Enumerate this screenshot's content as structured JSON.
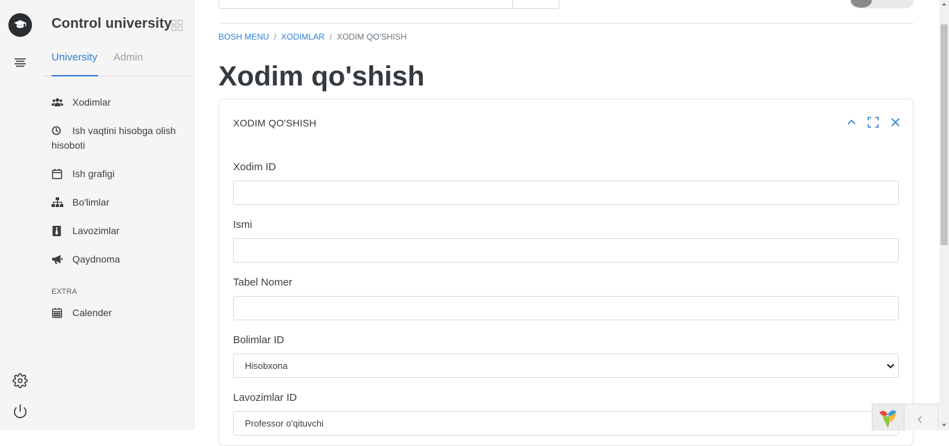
{
  "app": {
    "name": "Control university"
  },
  "tabs": [
    {
      "label": "University",
      "active": true
    },
    {
      "label": "Admin",
      "active": false
    }
  ],
  "nav": {
    "items": [
      {
        "label": "Xodimlar",
        "icon": "users-icon"
      },
      {
        "label": "Ish vaqtini hisobga olish hisoboti",
        "icon": "clock-icon"
      },
      {
        "label": "Ish grafigi",
        "icon": "calendar-icon"
      },
      {
        "label": "Bo'limlar",
        "icon": "sitemap-icon"
      },
      {
        "label": "Lavozimlar",
        "icon": "id-badge-icon"
      },
      {
        "label": "Qaydnoma",
        "icon": "megaphone-icon"
      }
    ],
    "extra_label": "EXTRA",
    "extra_items": [
      {
        "label": "Calender",
        "icon": "calendar-grid-icon"
      }
    ]
  },
  "breadcrumb": {
    "home": "BOSH MENU",
    "section": "XODIMLAR",
    "current": "XODIM QO'SHISH"
  },
  "page": {
    "title": "Xodim qo'shish"
  },
  "card": {
    "title": "XODIM QO'SHISH",
    "fields": [
      {
        "label": "Xodim ID",
        "type": "text",
        "value": ""
      },
      {
        "label": "Ismi",
        "type": "text",
        "value": ""
      },
      {
        "label": "Tabel Nomer",
        "type": "text",
        "value": ""
      },
      {
        "label": "Bolimlar ID",
        "type": "select",
        "value": "Hisobxona"
      },
      {
        "label": "Lavozimlar ID",
        "type": "select",
        "value": "Professor o'qituvchi"
      }
    ]
  },
  "colors": {
    "accent": "#2f7fd6",
    "sidebar_bg": "#f5f5f5",
    "text": "#343a40"
  }
}
